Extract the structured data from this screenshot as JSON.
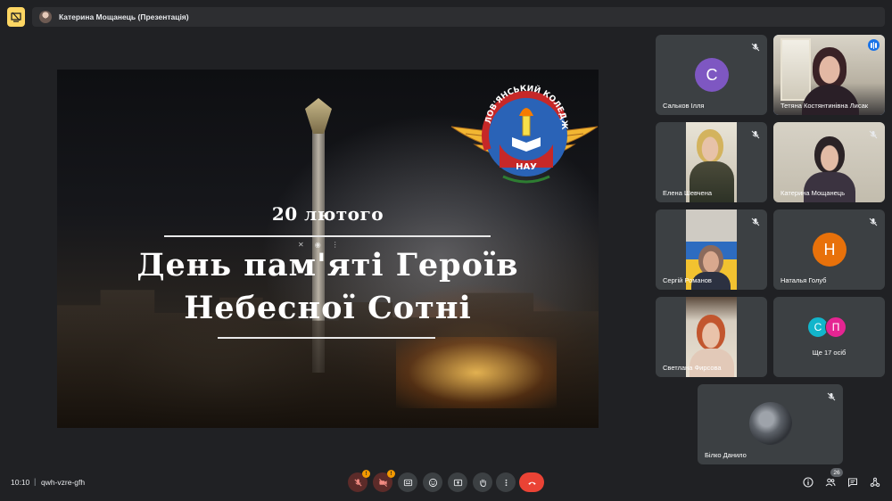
{
  "topbar": {
    "presenter_label": "Катерина Мощанець (Презентація)",
    "pin_icon": "presentation-icon"
  },
  "slide": {
    "logo_top_text": "СЛОВ'ЯНСЬКИЙ КОЛЕДЖ",
    "logo_bottom_text": "НАУ",
    "date": "20 лютого",
    "title_line1": "День пам'яті Героїв",
    "title_line2": "Небесної Сотні"
  },
  "participants": [
    {
      "name": "Сальков Ілля",
      "type": "avatar",
      "initial": "С",
      "color": "#7e57c2",
      "muted": true
    },
    {
      "name": "Тетяна Костянтинівна Лисак",
      "type": "video",
      "muted": false,
      "speaking": true
    },
    {
      "name": "Елена Шевчена",
      "type": "video",
      "muted": true
    },
    {
      "name": "Катерина Мощанець",
      "type": "video",
      "muted": true
    },
    {
      "name": "Сергій Романов",
      "type": "video",
      "muted": true
    },
    {
      "name": "Наталья Голуб",
      "type": "avatar",
      "initial": "Н",
      "color": "#e8710a",
      "muted": true
    },
    {
      "name": "Светлана Фирсова",
      "type": "video",
      "muted": false
    },
    {
      "name": "Ще 17 осіб",
      "type": "group",
      "initials": [
        "С",
        "П"
      ],
      "colors": [
        "#12b5cb",
        "#e52592"
      ]
    },
    {
      "name": "Білко Данило",
      "type": "image",
      "muted": true
    }
  ],
  "bottombar": {
    "time": "10:10",
    "separator": "|",
    "meeting_code": "qwh-vzre-gfh",
    "mic_alert": "!",
    "cam_alert": "!",
    "people_count": "26"
  },
  "colors": {
    "background": "#202124",
    "tile": "#3c4043",
    "accent_yellow": "#fdd663",
    "hangup_red": "#ea4335",
    "active_blue": "#8ab4f8"
  }
}
